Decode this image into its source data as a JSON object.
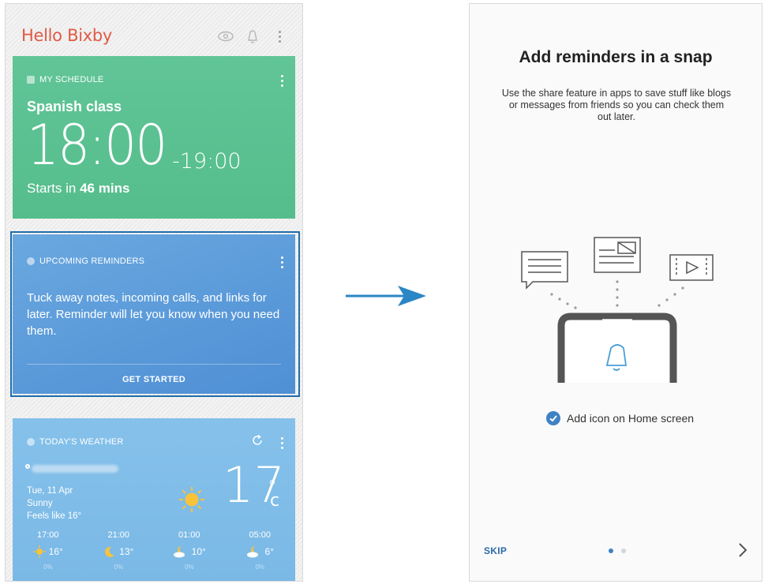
{
  "left_screen": {
    "app_title": "Hello Bixby",
    "schedule": {
      "title": "MY SCHEDULE",
      "event": "Spanish class",
      "start_time": "18:00",
      "end_time": "-19:00",
      "starts_prefix": "Starts in ",
      "starts_value": "46 mins"
    },
    "reminders": {
      "title": "UPCOMING REMINDERS",
      "body": "Tuck away notes, incoming calls, and links for later. Reminder will let you know when you need them.",
      "button": "GET STARTED"
    },
    "weather": {
      "title": "TODAY'S WEATHER",
      "date": "Tue, 11 Apr",
      "condition": "Sunny",
      "feels_like": "Feels like 16°",
      "temperature": "17",
      "unit": "c",
      "hourly": [
        {
          "time": "17:00",
          "icon": "sun-icon",
          "temp": "16°",
          "precip": "0%"
        },
        {
          "time": "21:00",
          "icon": "moon-icon",
          "temp": "13°",
          "precip": "0%"
        },
        {
          "time": "01:00",
          "icon": "moon-cloud-icon",
          "temp": "10°",
          "precip": "0%"
        },
        {
          "time": "05:00",
          "icon": "moon-cloud-icon",
          "temp": "6°",
          "precip": "0%"
        }
      ]
    }
  },
  "right_screen": {
    "title": "Add reminders in a snap",
    "description": "Use the share feature in apps to save stuff like blogs or messages from friends so you can check them out later.",
    "checkbox_label": "Add icon on Home screen",
    "checkbox_checked": true,
    "skip_label": "SKIP",
    "page_index": 1,
    "page_count": 2
  },
  "colors": {
    "brand": "#e05a45",
    "schedule_card": "#5bc291",
    "reminders_card": "#5b9bd9",
    "weather_card": "#80bde8",
    "accent_blue": "#3f82c4",
    "arrow": "#2b86c5"
  }
}
